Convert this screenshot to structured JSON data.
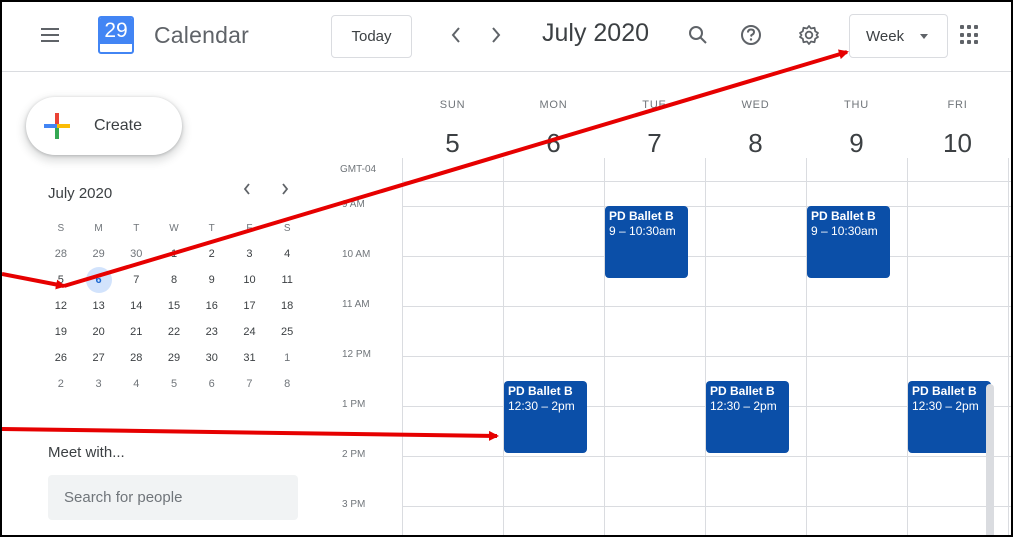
{
  "header": {
    "logo_day": "29",
    "app_name": "Calendar",
    "today_label": "Today",
    "prev_glyph": "‹",
    "next_glyph": "›",
    "month_title": "July 2020",
    "view_label": "Week",
    "icons": [
      "menu-icon",
      "search-icon",
      "help-icon",
      "settings-icon",
      "apps-icon"
    ]
  },
  "sidebar": {
    "create_label": "Create",
    "mini_cal": {
      "title": "July 2020",
      "dow": [
        "S",
        "M",
        "T",
        "W",
        "T",
        "F",
        "S"
      ],
      "weeks": [
        [
          "28",
          "29",
          "30",
          "1",
          "2",
          "3",
          "4"
        ],
        [
          "5",
          "6",
          "7",
          "8",
          "9",
          "10",
          "11"
        ],
        [
          "12",
          "13",
          "14",
          "15",
          "16",
          "17",
          "18"
        ],
        [
          "19",
          "20",
          "21",
          "22",
          "23",
          "24",
          "25"
        ],
        [
          "26",
          "27",
          "28",
          "29",
          "30",
          "31",
          "1"
        ],
        [
          "2",
          "3",
          "4",
          "5",
          "6",
          "7",
          "8"
        ]
      ],
      "dim_cells": [
        [
          0,
          0
        ],
        [
          0,
          1
        ],
        [
          0,
          2
        ],
        [
          4,
          6
        ],
        [
          5,
          0
        ],
        [
          5,
          1
        ],
        [
          5,
          2
        ],
        [
          5,
          3
        ],
        [
          5,
          4
        ],
        [
          5,
          5
        ],
        [
          5,
          6
        ]
      ],
      "today": [
        1,
        1
      ]
    },
    "meet_title": "Meet with...",
    "search_placeholder": "Search for people"
  },
  "week": {
    "timezone": "GMT-04",
    "days": [
      {
        "dow": "SUN",
        "num": "5"
      },
      {
        "dow": "MON",
        "num": "6"
      },
      {
        "dow": "TUE",
        "num": "7"
      },
      {
        "dow": "WED",
        "num": "8"
      },
      {
        "dow": "THU",
        "num": "9"
      },
      {
        "dow": "FRI",
        "num": "10"
      }
    ],
    "times": [
      "9 AM",
      "10 AM",
      "11 AM",
      "12 PM",
      "1 PM",
      "2 PM",
      "3 PM"
    ],
    "events": [
      {
        "title": "PD Ballet B",
        "time": "9 – 10:30am",
        "day": 2
      },
      {
        "title": "PD Ballet B",
        "time": "9 – 10:30am",
        "day": 4
      },
      {
        "title": "PD Ballet B",
        "time": "12:30 – 2pm",
        "day": 1
      },
      {
        "title": "PD Ballet B",
        "time": "12:30 – 2pm",
        "day": 3
      },
      {
        "title": "PD Ballet B",
        "time": "12:30 – 2pm",
        "day": 5
      }
    ],
    "event_color": "#0b4fa8"
  },
  "colors": {
    "accent": "#1a73e8",
    "today_bg": "#d2e3fc",
    "annotation_arrow": "#e60000"
  }
}
